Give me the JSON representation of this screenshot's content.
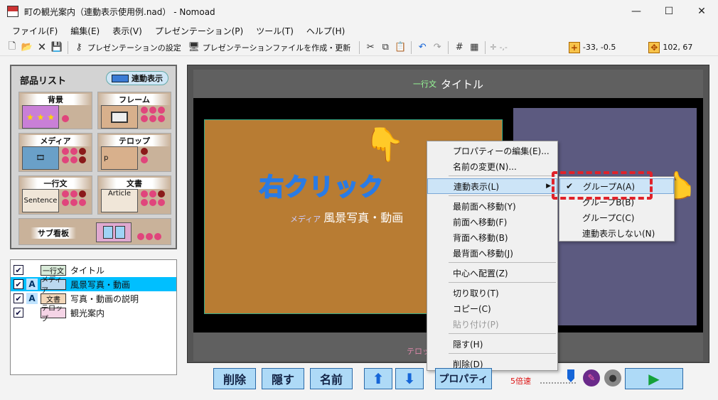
{
  "window": {
    "title": "町の観光案内（連動表示使用例.nad） - Nomoad",
    "minimize": "—",
    "maximize": "☐",
    "close": "✕"
  },
  "menu": [
    "ファイル(F)",
    "編集(E)",
    "表示(V)",
    "プレゼンテーション(P)",
    "ツール(T)",
    "ヘルプ(H)"
  ],
  "toolbar": {
    "settings_label": "プレゼンテーションの設定",
    "export_label": "プレゼンテーションファイルを作成・更新",
    "plus_readout": "-,-",
    "pos_readout": "-33, -0.5",
    "size_readout": "102, 67"
  },
  "parts": {
    "title": "部品リスト",
    "link_badge": "連動表示",
    "items": {
      "background": "背景",
      "frame": "フレーム",
      "media": "メディア",
      "telop": "テロップ",
      "oneline": "一行文",
      "document": "文書",
      "subboard": "サブ看板"
    },
    "oneline_thumb": "Sentence",
    "document_thumb": "Article",
    "telop_thumb": "p"
  },
  "layers": [
    {
      "check": "✔",
      "a": "",
      "type": "一行文",
      "name": "タイトル",
      "selected": false
    },
    {
      "check": "✔",
      "a": "A",
      "type": "メディア",
      "name": "風景写真・動画",
      "selected": true
    },
    {
      "check": "✔",
      "a": "A",
      "type": "文書",
      "name": "写真・動画の説明",
      "selected": false
    },
    {
      "check": "✔",
      "a": "",
      "type": "テロップ",
      "name": "観光案内",
      "selected": false
    }
  ],
  "stage": {
    "title_kind": "一行文",
    "title_text": "タイトル",
    "media_kind": "メディア",
    "media_text": "風景写真・動画",
    "telop_text": "テロップ",
    "annotation": "右クリック"
  },
  "context_menu": [
    "プロパティーの編集(E)...",
    "名前の変更(N)...",
    "連動表示(L)",
    "最前面へ移動(Y)",
    "前面へ移動(F)",
    "背面へ移動(B)",
    "最背面へ移動(J)",
    "中心へ配置(Z)",
    "切り取り(T)",
    "コピー(C)",
    "貼り付け(P)",
    "隠す(H)",
    "削除(D)"
  ],
  "submenu": [
    "グループA(A)",
    "グループB(B)",
    "グループC(C)",
    "連動表示しない(N)"
  ],
  "buttons": {
    "delete": "削除",
    "hide": "隠す",
    "name": "名前",
    "up": "⬆",
    "down": "⬇",
    "property": "プロパティ",
    "speed": "5倍速",
    "play": "▶"
  }
}
